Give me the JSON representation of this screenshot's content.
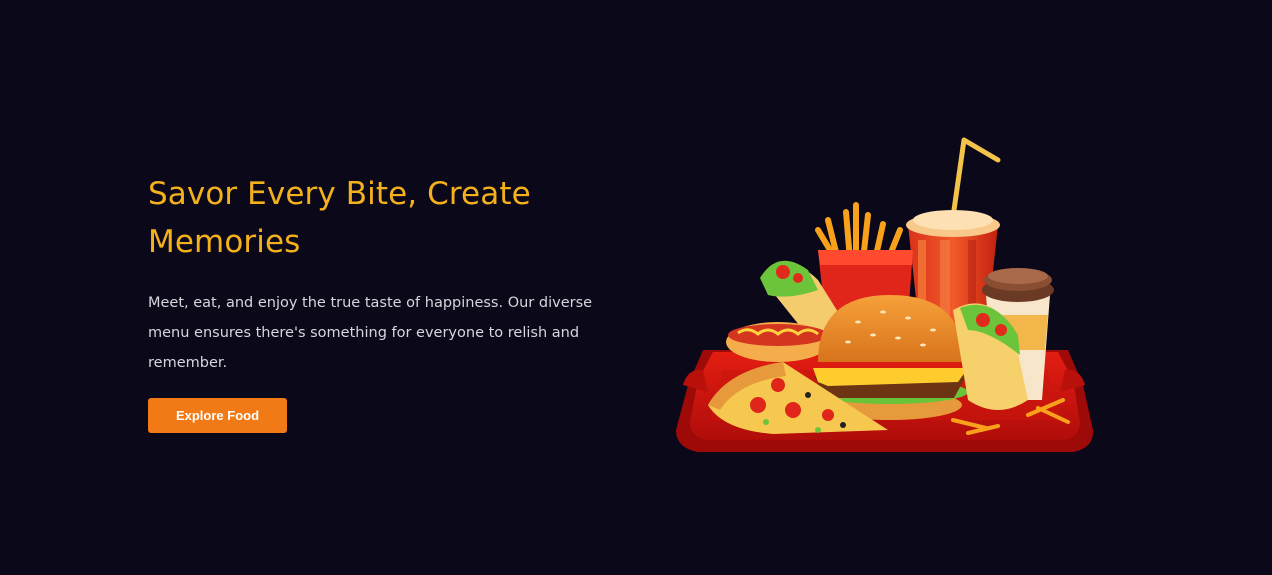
{
  "hero": {
    "title": "Savor Every Bite, Create Memories",
    "description": "Meet, eat, and enjoy the true taste of happiness. Our diverse menu ensures there's something for everyone to relish and remember.",
    "cta_label": "Explore Food"
  },
  "illustration": {
    "items": [
      "burger-icon",
      "pizza-slice-icon",
      "fries-icon",
      "soda-cup-icon",
      "coffee-cup-icon",
      "taco-icon",
      "burrito-icon",
      "hotdog-icon",
      "red-tray-icon"
    ]
  },
  "colors": {
    "background": "#0a0819",
    "title": "#f4b11c",
    "text": "#d6d6dd",
    "button": "#f27a16"
  }
}
